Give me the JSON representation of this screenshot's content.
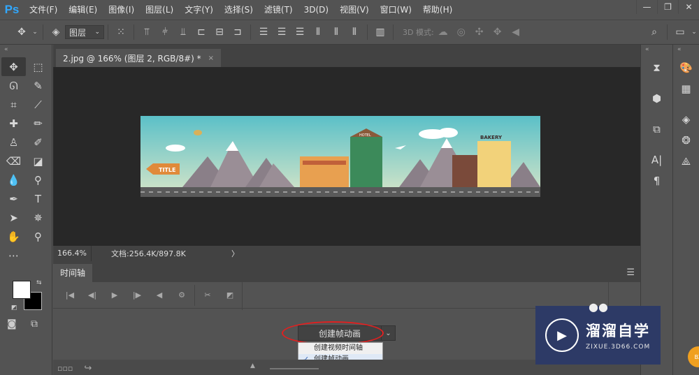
{
  "app": {
    "logo": "Ps"
  },
  "menu": [
    "文件(F)",
    "编辑(E)",
    "图像(I)",
    "图层(L)",
    "文字(Y)",
    "选择(S)",
    "滤镜(T)",
    "3D(D)",
    "视图(V)",
    "窗口(W)",
    "帮助(H)"
  ],
  "options_bar": {
    "layer_select": "图层",
    "mode_3d": "3D 模式:"
  },
  "document": {
    "tab_title": "2.jpg @ 166% (图层 2, RGB/8#) *",
    "close_glyph": "×"
  },
  "artwork_text": {
    "title_sign": "TITLE",
    "hotel_sign": "HOTEL",
    "bakery_sign": "BAKERY"
  },
  "status": {
    "zoom": "166.4%",
    "doc_size": "文档:256.4K/897.8K",
    "arrow": "〉"
  },
  "timeline": {
    "tab_label": "时间轴",
    "create_button": "创建帧动画",
    "dropdown_options": [
      "创建视频时间轴",
      "创建帧动画"
    ],
    "selected_option": "创建帧动画"
  },
  "watermark": {
    "cn": "溜溜自学",
    "url": "ZIXUE.3D66.COM",
    "badge": "BZ"
  },
  "colors": {
    "accent_ps": "#31a8ff",
    "highlight": "#e02020",
    "foreground": "#ffffff",
    "background": "#000000"
  }
}
